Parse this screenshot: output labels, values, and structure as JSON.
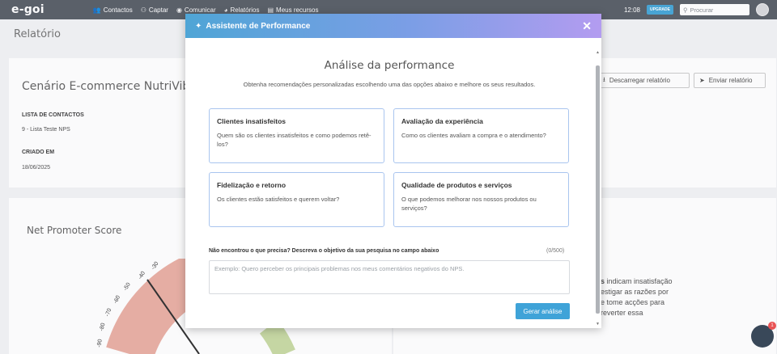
{
  "app": {
    "logo": "e-goi",
    "nav": [
      {
        "icon": "users-icon",
        "glyph": "👥",
        "label": "Contactos"
      },
      {
        "icon": "capture-icon",
        "glyph": "⚇",
        "label": "Captar"
      },
      {
        "icon": "eye-icon",
        "glyph": "◉",
        "label": "Comunicar"
      },
      {
        "icon": "chart-icon",
        "glyph": "◕",
        "label": "Relatórios"
      },
      {
        "icon": "folder-icon",
        "glyph": "▤",
        "label": "Meus recursos"
      }
    ],
    "clock": "12:08",
    "upgrade_label": "UPGRADE",
    "search_placeholder": "Procurar"
  },
  "background": {
    "page_title": "Relatório",
    "report_name": "Cenário E-commerce NutriVibes N",
    "contact_list_label": "LISTA DE CONTACTOS",
    "contact_list_value": "9 - Lista Teste NPS",
    "created_label": "CRIADO EM",
    "created_value": "18/06/2025",
    "download_button": "Descarregar relatório",
    "send_button": "Enviar relatório",
    "nps_title": "Net Promoter Score",
    "gauge_ticks": [
      "-30",
      "-40",
      "-50",
      "-60",
      "-70",
      "-80",
      "-90"
    ],
    "side_text_bold": "s",
    "side_text": [
      " indicam insatisfação",
      "estigar as razões por",
      "e tome acções para",
      "reverter essa"
    ],
    "chat_badge": "1"
  },
  "modal": {
    "title": "Assistente de Performance",
    "heading": "Análise da performance",
    "subheading": "Obtenha recomendações personalizadas escolhendo uma das opções abaixo e melhore os seus resultados.",
    "options": [
      {
        "title": "Clientes insatisfeitos",
        "description": "Quem são os clientes insatisfeitos e como podemos retê-los?"
      },
      {
        "title": "Avaliação da experiência",
        "description": "Como os clientes avaliam a compra e o atendimento?"
      },
      {
        "title": "Fidelização e retorno",
        "description": "Os clientes estão satisfeitos e querem voltar?"
      },
      {
        "title": "Qualidade de produtos e serviços",
        "description": "O que podemos melhorar nos nossos produtos ou serviços?"
      }
    ],
    "prompt_label": "Não encontrou o que precisa? Descreva o objetivo da sua pesquisa no campo abaixo",
    "char_count": "(0/500)",
    "textarea_placeholder": "Exemplo: Quero perceber os principais problemas nos meus comentários negativos do NPS.",
    "generate_button": "Gerar análise"
  },
  "colors": {
    "topbar": "#5c626b",
    "header_gradient_start": "#4fa5d6",
    "header_gradient_end": "#b39cf0",
    "option_border": "#a9c5ef",
    "primary_button": "#3fa3d8"
  }
}
